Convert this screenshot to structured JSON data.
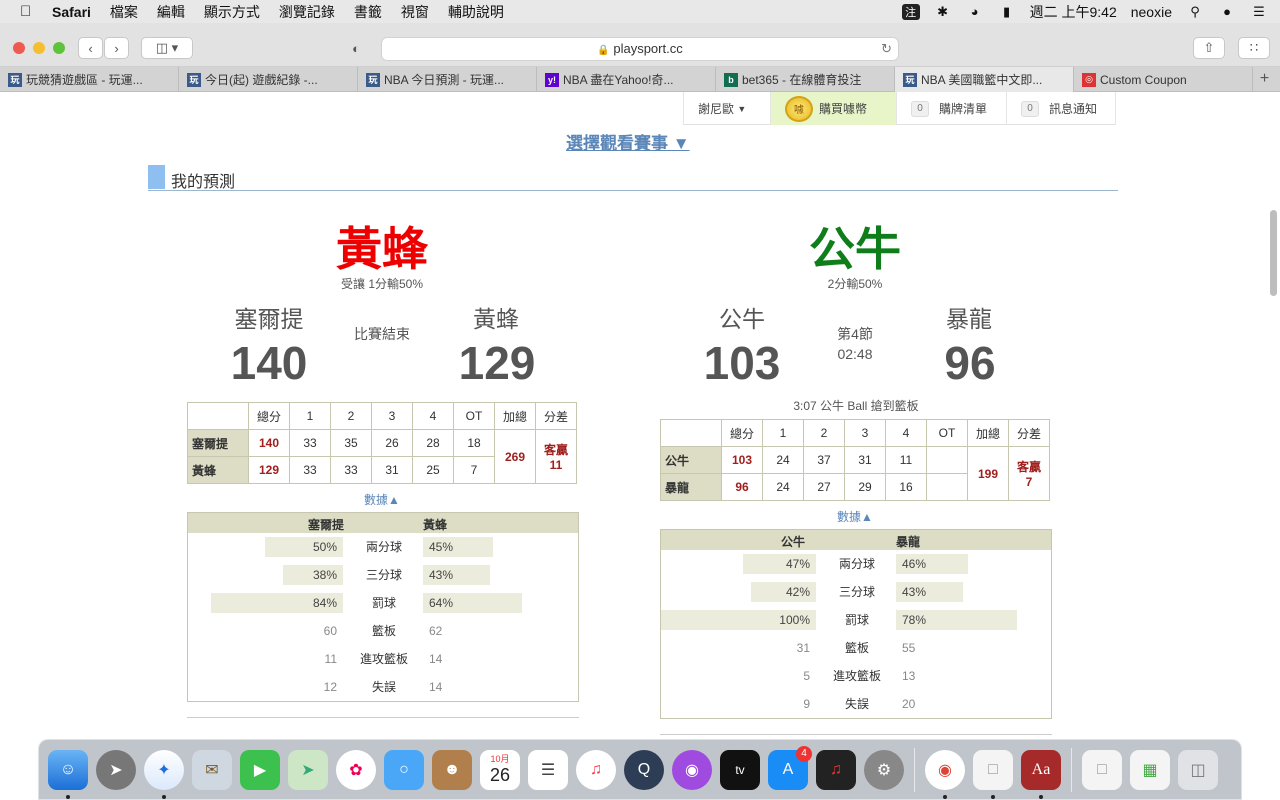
{
  "menubar": {
    "app": "Safari",
    "items": [
      "檔案",
      "編輯",
      "顯示方式",
      "瀏覽記錄",
      "書籤",
      "視窗",
      "輔助說明"
    ],
    "ime": "注",
    "datetime": "週二 上午9:42",
    "user": "neoxie"
  },
  "browser": {
    "url": "playsport.cc",
    "tabs": [
      {
        "label": "玩競猜遊戲區 - 玩運...",
        "fav": "玩",
        "color": "#3a5a8a"
      },
      {
        "label": "今日(起) 遊戲紀錄 -...",
        "fav": "玩",
        "color": "#3a5a8a"
      },
      {
        "label": "NBA 今日預測 - 玩運...",
        "fav": "玩",
        "color": "#3a5a8a"
      },
      {
        "label": "NBA 盡在Yahoo!奇...",
        "fav": "y!",
        "color": "#5f01d1"
      },
      {
        "label": "bet365 - 在線體育投注",
        "fav": "b",
        "color": "#126e51"
      },
      {
        "label": "NBA 美國職籃中文即...",
        "fav": "玩",
        "color": "#3a5a8a"
      },
      {
        "label": "Custom Coupon",
        "fav": "◎",
        "color": "#d33"
      }
    ]
  },
  "site": {
    "user_menu": "謝尼歐",
    "buy": "購買噱幣",
    "coin_label": "噱",
    "cart_count": "0",
    "cart": "購牌清單",
    "notice_count": "0",
    "notice": "訊息通知",
    "pick_game": "選擇觀看賽事 ▼",
    "section_title": "我的預測"
  },
  "game1": {
    "pick": "黃蜂",
    "pick_color": "#ee0000",
    "odds": "受讓 1分輸50%",
    "away": "塞爾提",
    "home": "黃蜂",
    "away_score": "140",
    "home_score": "129",
    "status": "比賽結束",
    "status2": "",
    "play": "",
    "headers": [
      "總分",
      "1",
      "2",
      "3",
      "4",
      "OT",
      "加總",
      "分差"
    ],
    "rows": [
      {
        "team": "塞爾提",
        "total": "140",
        "q": [
          "33",
          "35",
          "26",
          "28",
          "18"
        ]
      },
      {
        "team": "黃蜂",
        "total": "129",
        "q": [
          "33",
          "33",
          "31",
          "25",
          "7"
        ]
      }
    ],
    "sum": "269",
    "diff": "客贏\n11",
    "data_link": "數據▲",
    "stats": [
      {
        "label": "兩分球",
        "l": "50%",
        "r": "45%",
        "lw": 78,
        "rw": 70,
        "bar": true
      },
      {
        "label": "三分球",
        "l": "38%",
        "r": "43%",
        "lw": 60,
        "rw": 67,
        "bar": true
      },
      {
        "label": "罰球",
        "l": "84%",
        "r": "64%",
        "lw": 132,
        "rw": 99,
        "bar": true
      },
      {
        "label": "籃板",
        "l": "60",
        "r": "62",
        "bar": false
      },
      {
        "label": "進攻籃板",
        "l": "11",
        "r": "14",
        "bar": false
      },
      {
        "label": "失誤",
        "l": "12",
        "r": "14",
        "bar": false
      }
    ]
  },
  "game2": {
    "pick": "公牛",
    "pick_color": "#0f7d1a",
    "odds": "2分輸50%",
    "away": "公牛",
    "home": "暴龍",
    "away_score": "103",
    "home_score": "96",
    "status": "第4節",
    "status2": "02:48",
    "play": "3:07 公牛 Ball 搶到籃板",
    "headers": [
      "總分",
      "1",
      "2",
      "3",
      "4",
      "OT",
      "加總",
      "分差"
    ],
    "rows": [
      {
        "team": "公牛",
        "total": "103",
        "q": [
          "24",
          "37",
          "31",
          "11",
          ""
        ]
      },
      {
        "team": "暴龍",
        "total": "96",
        "q": [
          "24",
          "27",
          "29",
          "16",
          ""
        ]
      }
    ],
    "sum": "199",
    "diff": "客贏\n7",
    "data_link": "數據▲",
    "stats": [
      {
        "label": "兩分球",
        "l": "47%",
        "r": "46%",
        "lw": 73,
        "rw": 72,
        "bar": true
      },
      {
        "label": "三分球",
        "l": "42%",
        "r": "43%",
        "lw": 65,
        "rw": 67,
        "bar": true
      },
      {
        "label": "罰球",
        "l": "100%",
        "r": "78%",
        "lw": 155,
        "rw": 121,
        "bar": true
      },
      {
        "label": "籃板",
        "l": "31",
        "r": "55",
        "bar": false
      },
      {
        "label": "進攻籃板",
        "l": "5",
        "r": "13",
        "bar": false
      },
      {
        "label": "失誤",
        "l": "9",
        "r": "20",
        "bar": false
      }
    ]
  },
  "dock": {
    "calendar_month": "10月",
    "calendar_day": "26",
    "appstore_badge": "4"
  }
}
